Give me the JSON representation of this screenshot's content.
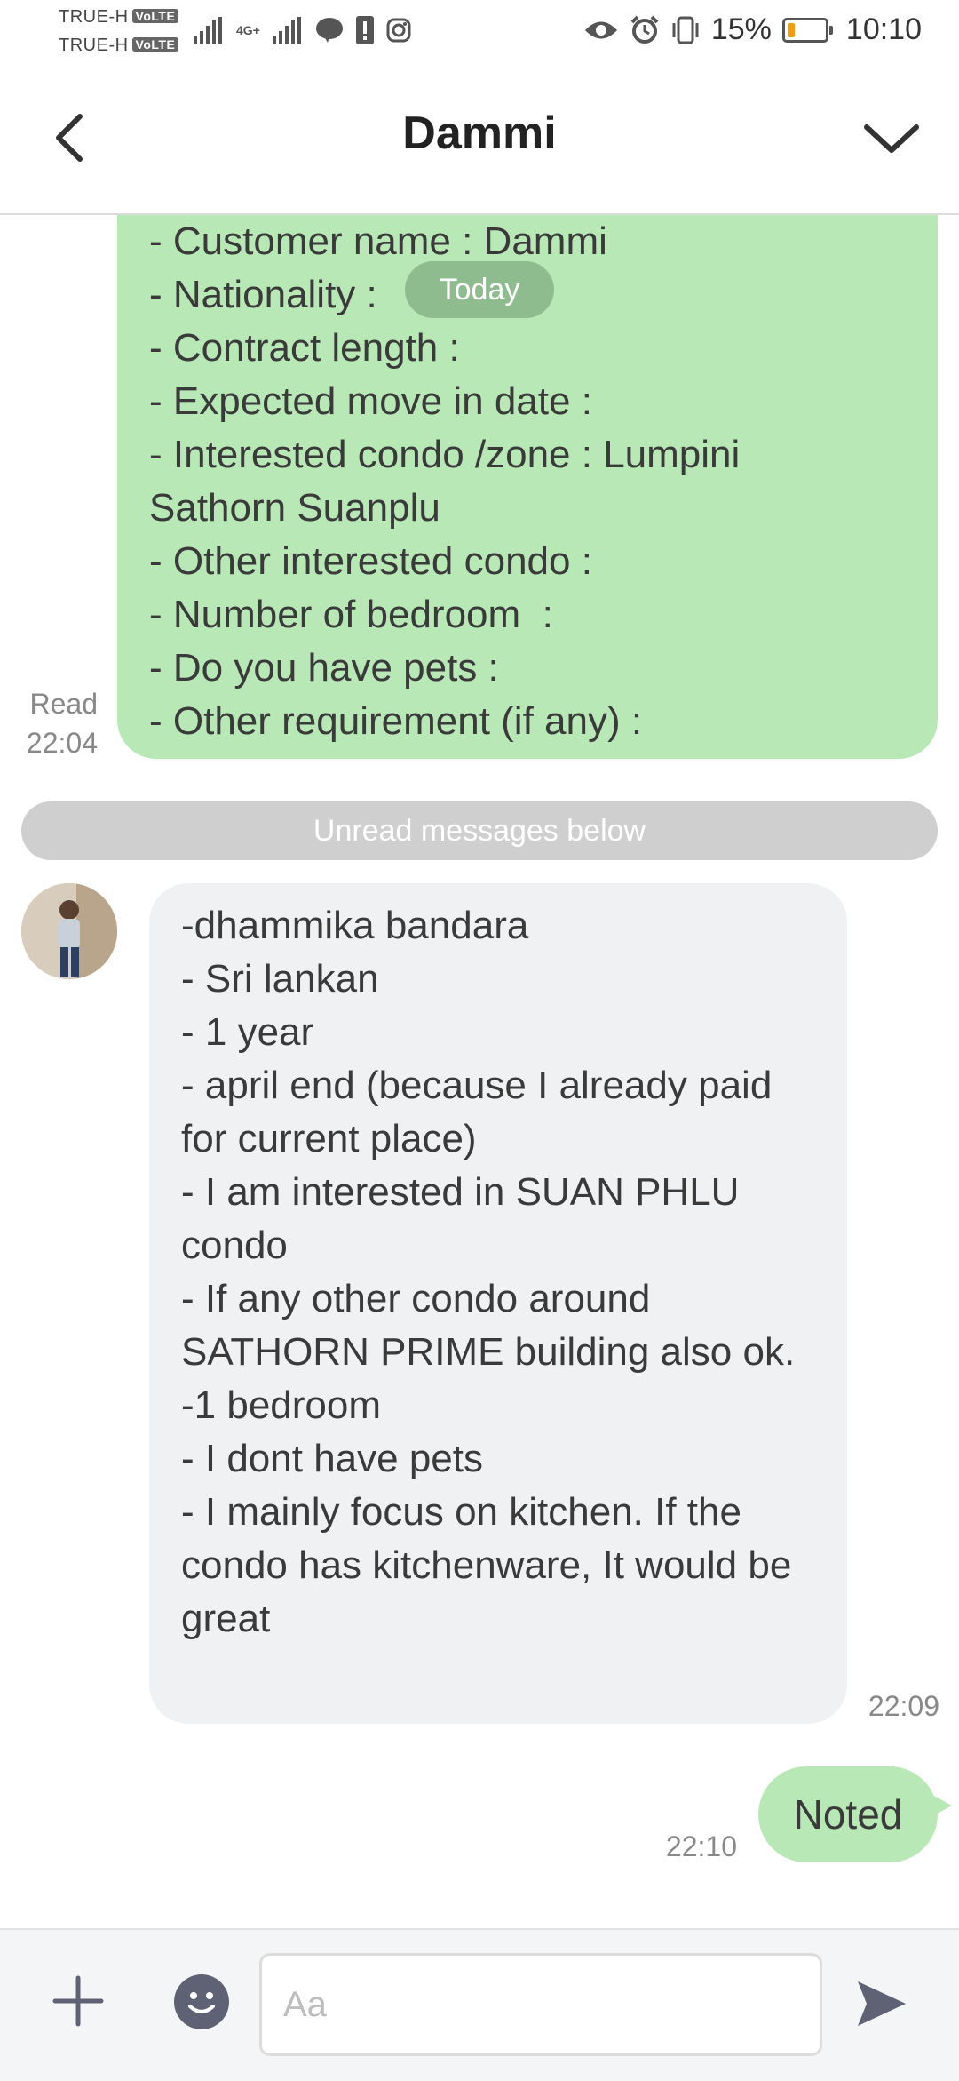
{
  "status_bar": {
    "carrier_1": "TRUE-H",
    "carrier_2": "TRUE-H",
    "volte_badge": "VoLTE",
    "network": "4G+",
    "battery": "15%",
    "time": "10:10",
    "colors": {
      "battery_fill": "#f39c12"
    }
  },
  "header": {
    "title": "Dammi"
  },
  "chat": {
    "outgoing_form": {
      "lines": [
        "- Customer name : Dammi",
        "- Nationality : ",
        "- Contract length : ",
        "- Expected move in date : ",
        "- Interested condo /zone : Lumpini",
        "Sathorn Suanplu",
        "- Other interested condo : ",
        "- Number of bedroom  : ",
        "- Do you have pets : ",
        "- Other requirement (if any) :"
      ],
      "read_label": "Read",
      "time": "22:04"
    },
    "date_pill": "Today",
    "unread_divider": "Unread messages below",
    "incoming_reply": {
      "lines": [
        "-dhammika bandara",
        "- Sri lankan",
        "- 1 year",
        "- april end (because I already paid for current place)",
        "- I am interested in SUAN PHLU condo",
        "- If any other condo around SATHORN PRIME building also ok.",
        "-1 bedroom",
        "- I dont have pets",
        "- I mainly focus on kitchen. If the condo has kitchenware, It would be great"
      ],
      "time": "22:09"
    },
    "outgoing_short": {
      "text": "Noted",
      "time": "22:10"
    },
    "colors": {
      "outgoing_bubble": "#b7e8b5",
      "incoming_bubble": "#f0f1f3"
    }
  },
  "input_bar": {
    "placeholder": "Aa",
    "value": ""
  }
}
